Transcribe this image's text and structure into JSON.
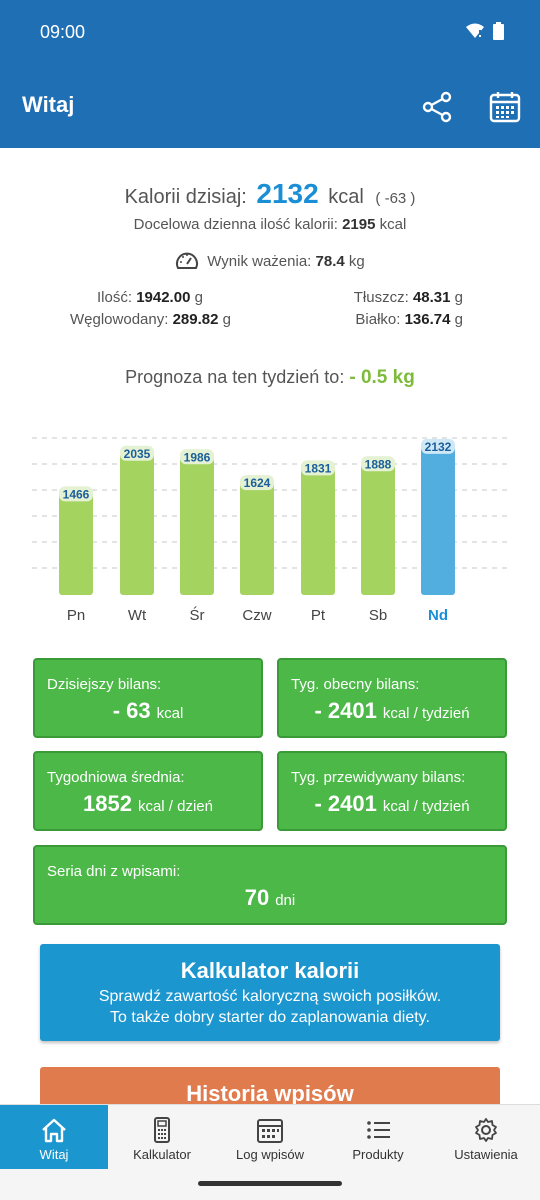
{
  "status": {
    "time": "09:00"
  },
  "appbar": {
    "title": "Witaj",
    "share_icon": "share-icon",
    "calendar_icon": "calendar-icon"
  },
  "summary": {
    "calories_label": "Kalorii dzisiaj:",
    "calories_value": "2132",
    "calories_unit": "kcal",
    "calories_diff": "( -63 )",
    "target_label": "Docelowa dzienna ilość kalorii:",
    "target_value": "2195",
    "target_unit": "kcal",
    "weigh_label": "Wynik ważenia:",
    "weigh_value": "78.4",
    "weigh_unit": "kg"
  },
  "macros": {
    "amount_label": "Ilość:",
    "amount_value": "1942.00",
    "amount_unit": "g",
    "carbs_label": "Węglowodany:",
    "carbs_value": "289.82",
    "carbs_unit": "g",
    "fat_label": "Tłuszcz:",
    "fat_value": "48.31",
    "fat_unit": "g",
    "protein_label": "Białko:",
    "protein_value": "136.74",
    "protein_unit": "g"
  },
  "forecast": {
    "label": "Prognoza na ten tydzień to:",
    "value": "- 0.5 kg"
  },
  "chart_data": {
    "type": "bar",
    "categories": [
      "Pn",
      "Wt",
      "Śr",
      "Czw",
      "Pt",
      "Sb",
      "Nd"
    ],
    "values": [
      1466,
      2035,
      1986,
      1624,
      1831,
      1888,
      2132
    ],
    "highlight_index": 6,
    "ylim": [
      0,
      2200
    ],
    "grid": true,
    "colors": {
      "normal": "#a5d35f",
      "highlight": "#52aedf",
      "label": "#1a5f9a",
      "highlight_label": "#1a8fd6"
    }
  },
  "cards": {
    "today": {
      "label": "Dzisiejszy bilans:",
      "value": "- 63",
      "unit": "kcal"
    },
    "week_current": {
      "label": "Tyg. obecny bilans:",
      "value": "- 2401",
      "unit": "kcal / tydzień"
    },
    "week_avg": {
      "label": "Tygodniowa średnia:",
      "value": "1852",
      "unit": "kcal / dzień"
    },
    "week_forecast": {
      "label": "Tyg. przewidywany bilans:",
      "value": "- 2401",
      "unit": "kcal / tydzień"
    },
    "streak": {
      "label": "Seria dni z wpisami:",
      "value": "70",
      "unit": "dni"
    }
  },
  "buttons": {
    "calculator_title": "Kalkulator kalorii",
    "calculator_sub1": "Sprawdź zawartość kaloryczną swoich posiłków.",
    "calculator_sub2": "To także dobry starter do zaplanowania diety.",
    "history_title": "Historia wpisów"
  },
  "nav": [
    {
      "label": "Witaj",
      "icon": "home-icon"
    },
    {
      "label": "Kalkulator",
      "icon": "calculator-icon"
    },
    {
      "label": "Log wpisów",
      "icon": "calendar-icon"
    },
    {
      "label": "Produkty",
      "icon": "list-icon"
    },
    {
      "label": "Ustawienia",
      "icon": "gear-icon"
    }
  ],
  "colors": {
    "primary": "#1f6fb5",
    "accent": "#1b96cf",
    "green": "#4cb848",
    "orange": "#e07b4e"
  }
}
